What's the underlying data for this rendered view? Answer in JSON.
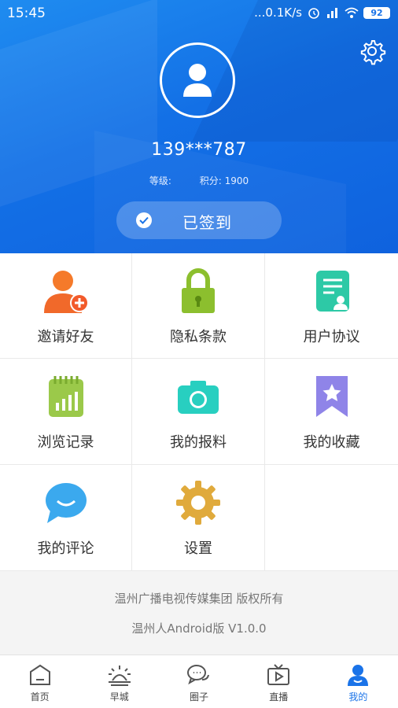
{
  "status_bar": {
    "time": "15:45",
    "network_speed": "...0.1K/s",
    "battery": "92"
  },
  "profile": {
    "phone": "139***787",
    "level_label": "等级:",
    "points_label": "积分: 1900",
    "signin_label": "已签到"
  },
  "menu": {
    "items": [
      {
        "label": "邀请好友",
        "icon": "invite-friend-icon"
      },
      {
        "label": "隐私条款",
        "icon": "privacy-lock-icon"
      },
      {
        "label": "用户协议",
        "icon": "user-agreement-icon"
      },
      {
        "label": "浏览记录",
        "icon": "history-icon"
      },
      {
        "label": "我的报料",
        "icon": "camera-icon"
      },
      {
        "label": "我的收藏",
        "icon": "bookmark-icon"
      },
      {
        "label": "我的评论",
        "icon": "comment-icon"
      },
      {
        "label": "设置",
        "icon": "gear-icon"
      }
    ]
  },
  "footer": {
    "copyright": "温州广播电视传媒集团 版权所有",
    "version": "温州人Android版 V1.0.0"
  },
  "tabs": [
    {
      "label": "首页",
      "icon": "home-icon"
    },
    {
      "label": "早城",
      "icon": "sunrise-icon"
    },
    {
      "label": "圈子",
      "icon": "chat-bubbles-icon"
    },
    {
      "label": "直播",
      "icon": "tv-icon"
    },
    {
      "label": "我的",
      "icon": "user-icon",
      "active": true
    }
  ],
  "colors": {
    "header_blue": "#1370e6",
    "active_tab": "#1a73e8"
  }
}
